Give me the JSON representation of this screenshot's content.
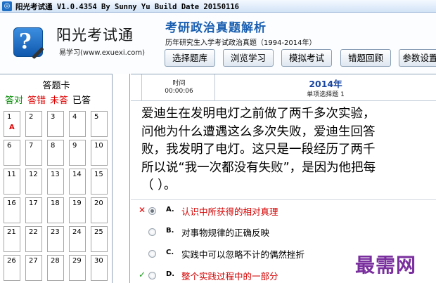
{
  "window": {
    "title": "阳光考试通 V1.0.4354 By Sunny Yu  Build Date 20150116"
  },
  "header": {
    "logo_glyph": "?",
    "app_name": "阳光考试通",
    "app_subtitle": "易学习(www.exuexi.com)",
    "headline": "考研政治真题解析",
    "subline": "历年研究生入学考试政治真题（1994-2014年）"
  },
  "toolbar": {
    "buttons": [
      {
        "label": "选择题库"
      },
      {
        "label": "浏览学习"
      },
      {
        "label": "模拟考试"
      },
      {
        "label": "错题回顾"
      },
      {
        "label": "参数设置"
      }
    ]
  },
  "answer_card": {
    "title": "答题卡",
    "legend": [
      {
        "label": "答对",
        "color": "#008800"
      },
      {
        "label": "答错",
        "color": "#e00000"
      },
      {
        "label": "未答",
        "color": "#e00000"
      },
      {
        "label": "已答",
        "color": "#000000"
      }
    ],
    "cells": [
      {
        "num": "1",
        "ans": "A"
      },
      {
        "num": "2",
        "ans": ""
      },
      {
        "num": "3",
        "ans": ""
      },
      {
        "num": "4",
        "ans": ""
      },
      {
        "num": "5",
        "ans": ""
      },
      {
        "num": "6",
        "ans": ""
      },
      {
        "num": "7",
        "ans": ""
      },
      {
        "num": "8",
        "ans": ""
      },
      {
        "num": "9",
        "ans": ""
      },
      {
        "num": "10",
        "ans": ""
      },
      {
        "num": "11",
        "ans": ""
      },
      {
        "num": "12",
        "ans": ""
      },
      {
        "num": "13",
        "ans": ""
      },
      {
        "num": "14",
        "ans": ""
      },
      {
        "num": "15",
        "ans": ""
      },
      {
        "num": "16",
        "ans": ""
      },
      {
        "num": "17",
        "ans": ""
      },
      {
        "num": "18",
        "ans": ""
      },
      {
        "num": "19",
        "ans": ""
      },
      {
        "num": "20",
        "ans": ""
      },
      {
        "num": "21",
        "ans": ""
      },
      {
        "num": "22",
        "ans": ""
      },
      {
        "num": "23",
        "ans": ""
      },
      {
        "num": "24",
        "ans": ""
      },
      {
        "num": "25",
        "ans": ""
      },
      {
        "num": "26",
        "ans": ""
      },
      {
        "num": "27",
        "ans": ""
      },
      {
        "num": "28",
        "ans": ""
      },
      {
        "num": "29",
        "ans": ""
      },
      {
        "num": "30",
        "ans": ""
      }
    ]
  },
  "info": {
    "time_label": "时间",
    "time_value": "00:00:06",
    "year": "2014年",
    "question_type": "单项选择题 1"
  },
  "question": {
    "lines": [
      "爱迪生在发明电灯之前做了两千多次实验，",
      "问他为什么遭遇这么多次失败，爱迪生回答",
      "败，我发明了电灯。这只是一段经历了两千",
      "所以说“我一次都没有失败”，是因为他把每",
      "（ ）。"
    ]
  },
  "options": [
    {
      "mark": "✕",
      "mark_color": "#e00000",
      "letter": "A.",
      "text": "认识中所获得的相对真理",
      "red": true,
      "checked": true
    },
    {
      "mark": "",
      "mark_color": "#000000",
      "letter": "B.",
      "text": "对事物规律的正确反映",
      "red": false,
      "checked": false
    },
    {
      "mark": "",
      "mark_color": "#000000",
      "letter": "C.",
      "text": "实践中可以忽略不计的偶然挫折",
      "red": false,
      "checked": false
    },
    {
      "mark": "✓",
      "mark_color": "#1a9a1a",
      "letter": "D.",
      "text": "整个实践过程中的一部分",
      "red": true,
      "checked": false
    }
  ],
  "watermark": "最需网"
}
